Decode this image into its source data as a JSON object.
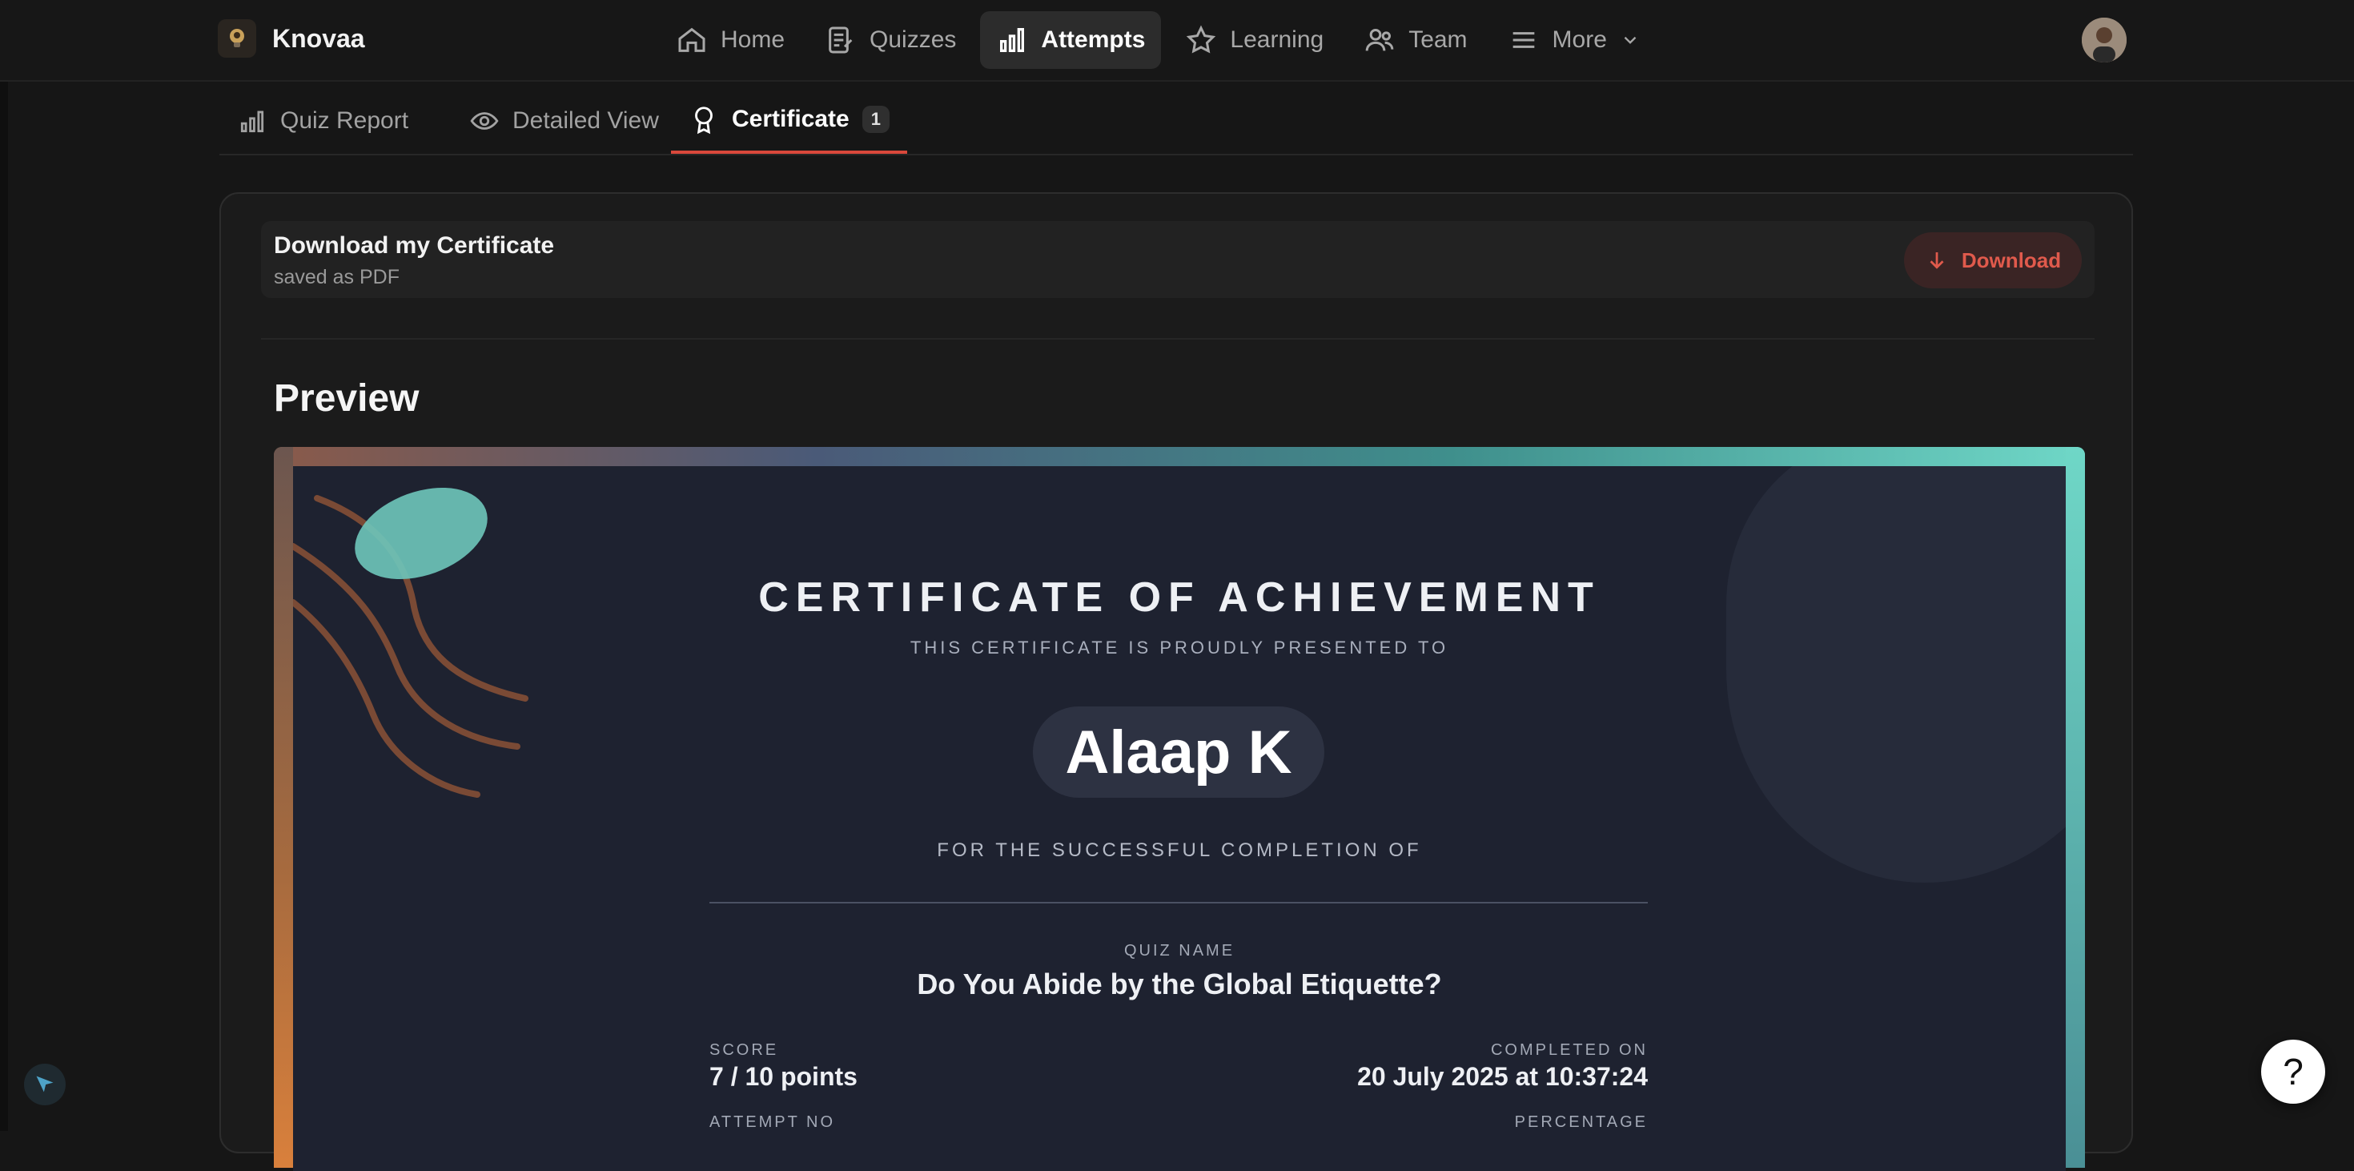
{
  "app": {
    "name": "Knovaa",
    "logo_icon": "bulb-logo-icon"
  },
  "nav": {
    "items": [
      {
        "label": "Home",
        "icon": "home-icon",
        "active": false
      },
      {
        "label": "Quizzes",
        "icon": "quizzes-icon",
        "active": false
      },
      {
        "label": "Attempts",
        "icon": "bar-chart-icon",
        "active": true
      },
      {
        "label": "Learning",
        "icon": "star-icon",
        "active": false
      },
      {
        "label": "Team",
        "icon": "team-icon",
        "active": false
      },
      {
        "label": "More",
        "icon": "menu-icon",
        "active": false
      }
    ]
  },
  "subtabs": {
    "items": [
      {
        "label": "Quiz Report",
        "icon": "bar-chart-icon"
      },
      {
        "label": "Detailed View",
        "icon": "eye-icon"
      },
      {
        "label": "Certificate",
        "icon": "award-icon",
        "badge": "1",
        "active": true
      }
    ]
  },
  "download": {
    "title": "Download my Certificate",
    "subtitle": "saved as PDF",
    "button_label": "Download"
  },
  "preview": {
    "title": "Preview"
  },
  "certificate": {
    "heading": "CERTIFICATE OF ACHIEVEMENT",
    "presented_to": "THIS CERTIFICATE IS PROUDLY PRESENTED TO",
    "recipient": "Alaap K",
    "for_completion": "FOR THE SUCCESSFUL COMPLETION OF",
    "quiz_name_label": "QUIZ NAME",
    "quiz_name": "Do You Abide by the Global Etiquette?",
    "score_label": "SCORE",
    "score_value": "7 / 10 points",
    "completed_label": "COMPLETED ON",
    "completed_value": "20 July 2025 at 10:37:24",
    "attempt_label": "ATTEMPT NO",
    "percentage_label": "PERCENTAGE"
  },
  "help": {
    "label": "?"
  },
  "colors": {
    "accent": "#d9483b",
    "teal": "#6fd7c7",
    "copper": "#a86b3e"
  }
}
